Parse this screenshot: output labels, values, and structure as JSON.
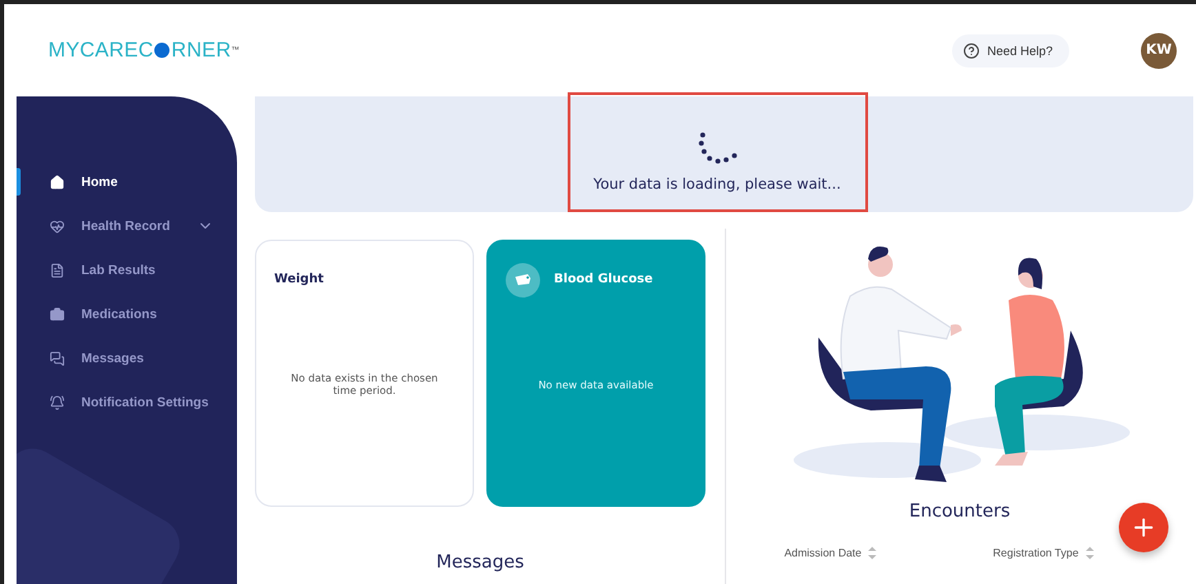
{
  "header": {
    "logo": {
      "before": "MYCAREC",
      "after": "RNER",
      "mark": "™"
    },
    "help_button": "Need Help?",
    "avatar": "KW"
  },
  "sidebar": {
    "items": [
      {
        "label": "Home",
        "kind": "link",
        "selected": true
      },
      {
        "label": "Health Record",
        "kind": "group",
        "selected": false,
        "expanded": false
      },
      {
        "label": "Lab Results",
        "kind": "link",
        "selected": false
      },
      {
        "label": "Medications",
        "kind": "link",
        "selected": false
      },
      {
        "label": "Messages",
        "kind": "link",
        "selected": false
      },
      {
        "label": "Notification Settings",
        "kind": "link",
        "selected": false
      }
    ]
  },
  "loading": {
    "message": "Your data is loading, please wait..."
  },
  "cards": [
    {
      "title": "Weight",
      "kind": "plain",
      "message": "No data exists in the chosen time period."
    },
    {
      "title": "Blood Glucose",
      "kind": "accent",
      "message": "No new data available"
    }
  ],
  "messages": {
    "title": "Messages"
  },
  "encounters": {
    "title": "Encounters",
    "columns": [
      "Admission Date",
      "Registration Type"
    ]
  }
}
